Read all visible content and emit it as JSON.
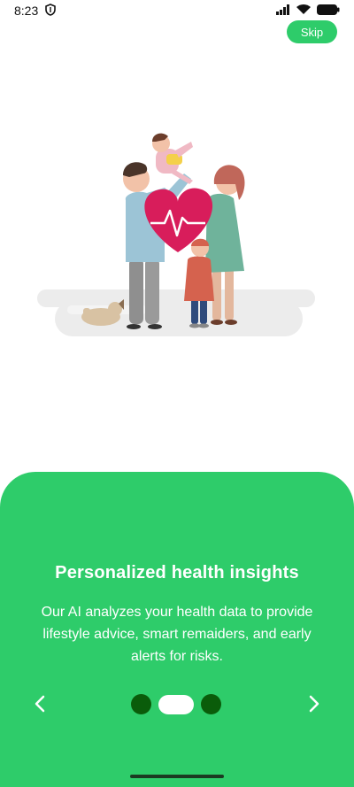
{
  "status_bar": {
    "time": "8:23",
    "icons": [
      "shield-icon",
      "signal-icon",
      "wifi-icon",
      "battery-icon"
    ]
  },
  "header": {
    "skip_label": "Skip"
  },
  "illustration": {
    "subject": "family-health-heart-illustration"
  },
  "onboarding": {
    "title": "Personalized health insights",
    "description": "Our AI analyzes your health data to provide lifestyle advice, smart remaiders, and early alerts for risks.",
    "current_page": 2,
    "total_pages": 3
  },
  "colors": {
    "accent": "#2ecc6a",
    "dot_inactive": "#0a5c0a",
    "dot_active": "#ffffff"
  }
}
